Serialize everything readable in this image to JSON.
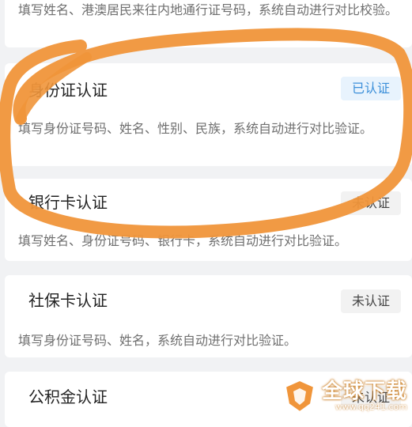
{
  "cards": [
    {
      "title": "",
      "desc": "填写姓名、港澳居民来往内地通行证号码，系统自动进行对比校验。",
      "status": ""
    },
    {
      "title": "身份证认证",
      "desc": "填写身份证号码、姓名、性别、民族，系统自动进行对比验证。",
      "status": "已认证"
    },
    {
      "title": "银行卡认证",
      "desc": "填写姓名、身份证号码、银行卡，系统自动进行对比验证。",
      "status": "未认证"
    },
    {
      "title": "社保卡认证",
      "desc": "填写身份证号码、姓名，系统自动进行对比验证。",
      "status": "未认证"
    },
    {
      "title": "公积金认证",
      "desc": "",
      "status": "未认证"
    }
  ],
  "watermark": {
    "text": "全球下载",
    "url": "www.qq241.com"
  },
  "colors": {
    "annotation_stroke": "#f0953a",
    "verified_badge_text": "#3b8fd9",
    "verified_badge_bg": "#e8f3fd"
  }
}
